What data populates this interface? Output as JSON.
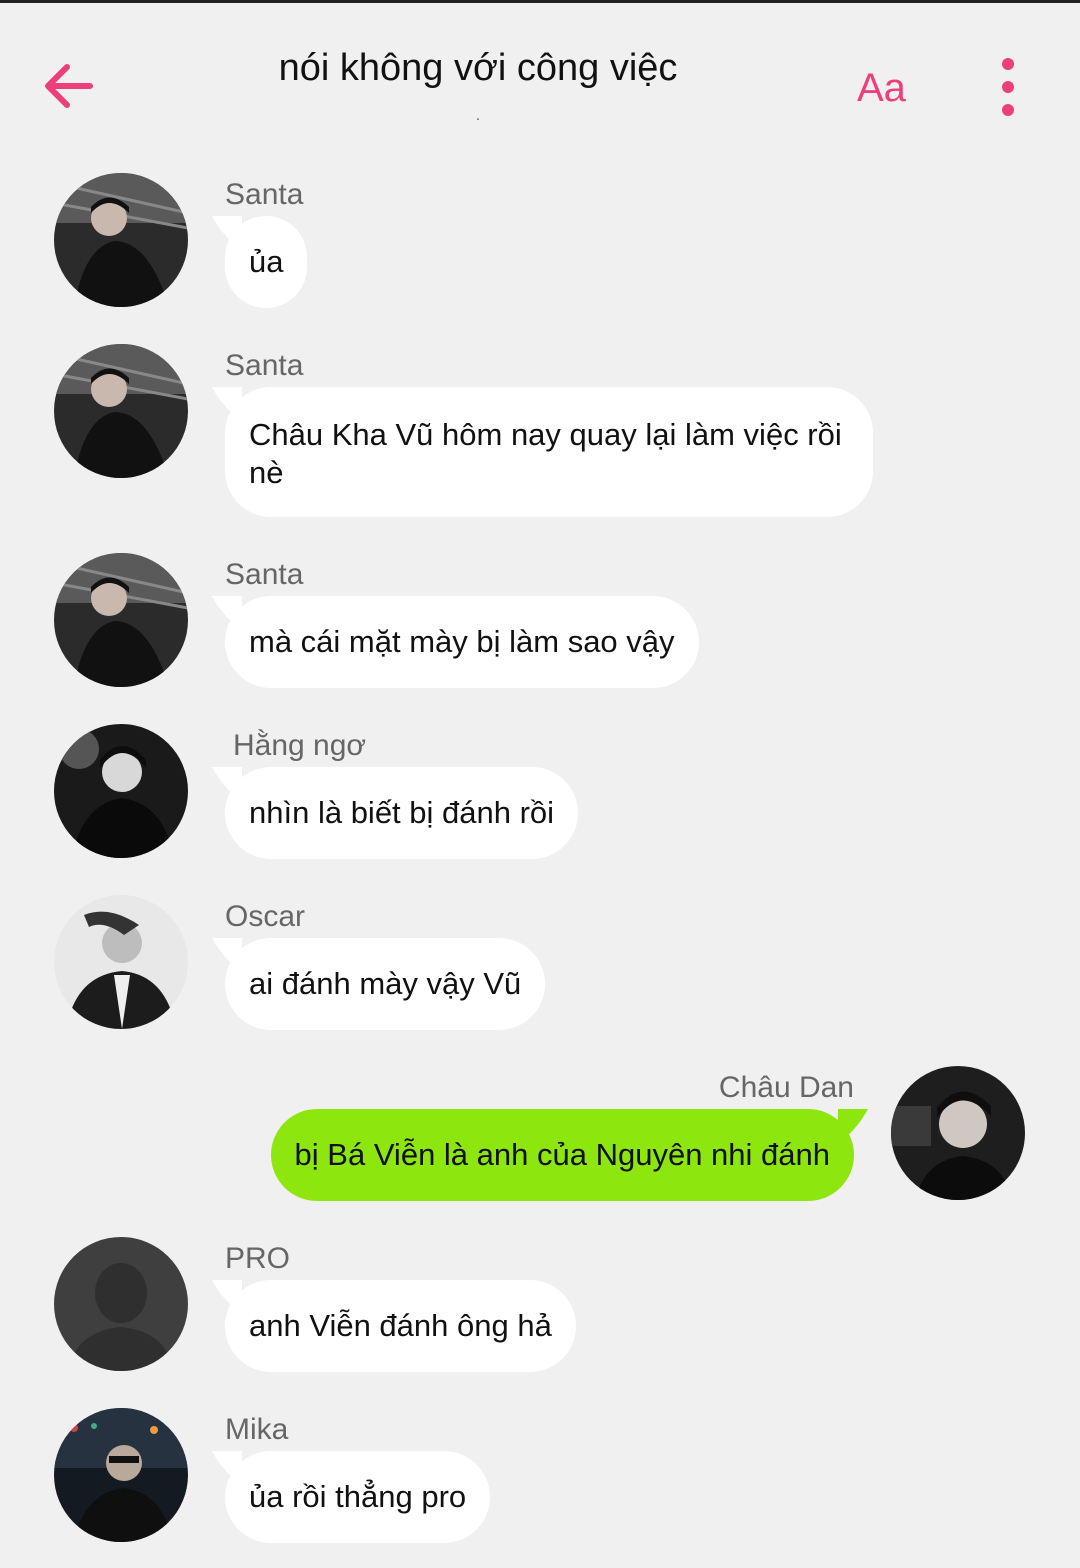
{
  "header": {
    "title": "nói không với công việc",
    "subtitle": ".",
    "font_button": "Aa",
    "back_icon": "arrow-left-icon",
    "menu_icon": "more-vertical-icon",
    "accent_color": "#ee3f7d"
  },
  "messages": [
    {
      "sender": "Santa",
      "text": "ủa"
    },
    {
      "sender": "Santa",
      "text": "Châu Kha Vũ hôm nay quay lại làm việc rồi nè"
    },
    {
      "sender": "Santa",
      "text": "mà cái mặt mày bị làm sao vậy"
    },
    {
      "sender": "Hằng ngơ",
      "text": "nhìn là biết bị đánh rồi"
    },
    {
      "sender": "Oscar",
      "text": "ai đánh mày vậy Vũ"
    },
    {
      "sender": "Châu Dan",
      "text": "bị Bá Viễn là anh của Nguyên nhi đánh",
      "own": true
    },
    {
      "sender": "PRO",
      "text": "anh Viễn đánh ông hả"
    },
    {
      "sender": "Mika",
      "text": "ủa rồi thẳng pro"
    }
  ],
  "colors": {
    "background": "#f0f0f0",
    "incoming_bubble": "#ffffff",
    "own_bubble": "#8de60d"
  }
}
